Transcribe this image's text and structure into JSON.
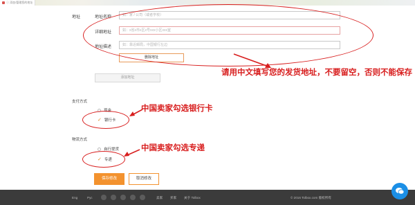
{
  "browser": {
    "tab_title": "ⓘ 添加/管理您的地址"
  },
  "address_form": {
    "address_name_label": "地址名称",
    "address_name_placeholder": "如：家 / 公司（或者学校）",
    "detail_label": "详细地址",
    "detail_placeholder": "如：x省x市x区x号xxx小区xxx室",
    "notes_label": "地址描述",
    "notes_placeholder": "如：靠近邮局，中国银行左边",
    "section_label": "地址",
    "delete_button": "删除地址",
    "add_button": "添加地址"
  },
  "payment": {
    "title": "支付方式",
    "options": [
      {
        "label": "现金",
        "selected": false
      },
      {
        "label": "银行卡",
        "selected": true
      }
    ]
  },
  "delivery": {
    "title": "物流方式",
    "options": [
      {
        "label": "自行提货",
        "selected": false
      },
      {
        "label": "专递",
        "selected": true
      }
    ]
  },
  "annotations": {
    "address_note": "请用中文填写您的发货地址，不要留空，否则不能保存",
    "payment_note": "中国卖家勾选银行卡",
    "delivery_note": "中国卖家勾选专递"
  },
  "actions": {
    "save": "保存修改",
    "cancel": "取消修改"
  },
  "footer": {
    "lang_en": "Eng",
    "lang_ru": "Рус",
    "links": [
      "卖家",
      "买家",
      "关于 Tolbox"
    ],
    "copyright": "© 2016 Tolbox.com 版权所有"
  },
  "colors": {
    "accent": "#f3922e",
    "annotation": "#d81e1e",
    "footer_bg": "#3b3b3b",
    "chat": "#1b8fe6"
  }
}
